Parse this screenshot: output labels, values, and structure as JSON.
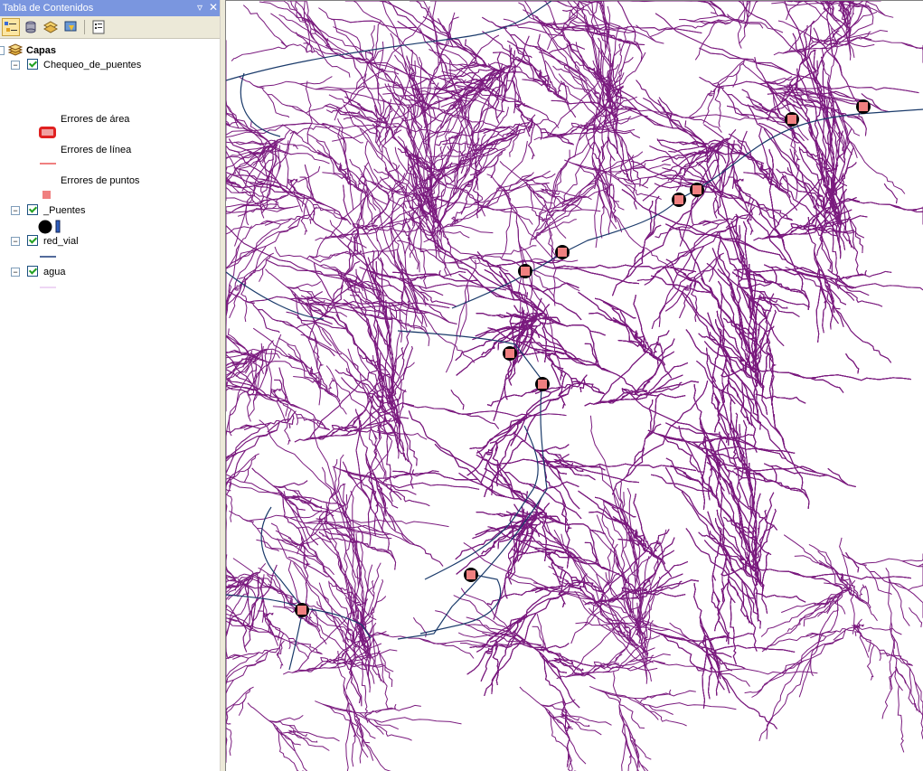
{
  "toc": {
    "title": "Tabla de Contenidos",
    "pin_glyph": "▿",
    "close_glyph": "✕",
    "toolbar": [
      {
        "name": "list-by-drawing-order-icon"
      },
      {
        "name": "list-by-source-icon"
      },
      {
        "name": "list-by-visibility-icon"
      },
      {
        "name": "list-by-selection-icon"
      },
      {
        "name": "options-icon"
      }
    ],
    "root_label": "Capas",
    "layers": [
      {
        "label": "Chequeo_de_puentes",
        "checked": true,
        "legend": [
          {
            "label": "Errores de área",
            "symbol": "area",
            "color": "#e02020"
          },
          {
            "label": "Errores de línea",
            "symbol": "line",
            "color": "#f08080"
          },
          {
            "label": "Errores de puntos",
            "symbol": "point",
            "color": "#f08080"
          }
        ]
      },
      {
        "label": "_Puentes",
        "checked": true,
        "symbol": "black-circle-bridge"
      },
      {
        "label": "red_vial",
        "checked": true,
        "symbol": "line",
        "color": "#1a3a7a"
      },
      {
        "label": "agua",
        "checked": true,
        "symbol": "line",
        "color": "#e8c8f0"
      }
    ]
  },
  "map": {
    "water_color": "#7a1a7e",
    "road_color": "#1a3a6a",
    "bridge_fill": "#f08080",
    "bridge_outline": "#000000",
    "bridge_count": 10
  }
}
